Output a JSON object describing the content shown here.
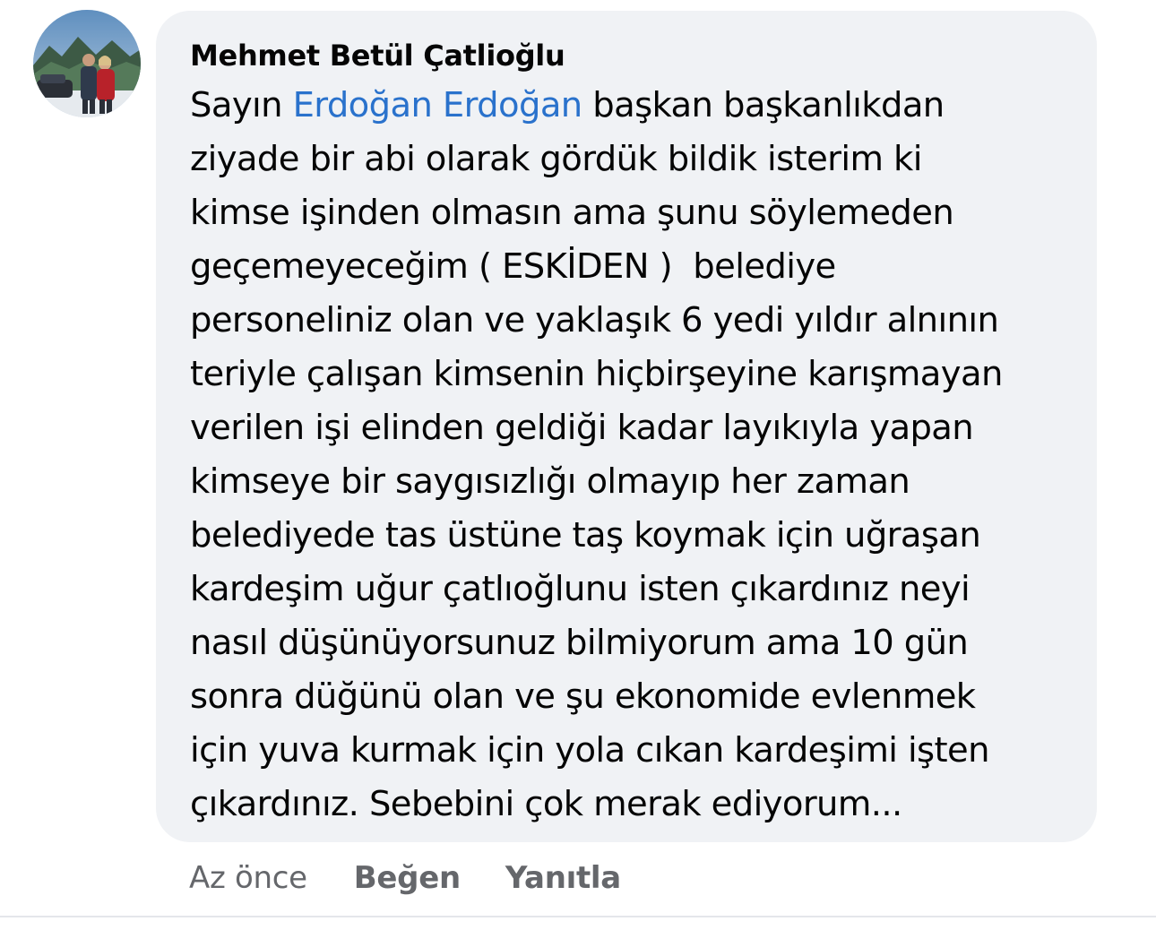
{
  "comment": {
    "author": "Mehmet Betül Çatlioğlu",
    "avatar_alt": "profile-photo",
    "body": {
      "line1_prefix": "Sayın ",
      "mention": "Erdoğan Erdoğan",
      "line1_suffix": " başkan başkanlıkdan",
      "lines": [
        "ziyade bir abi olarak gördük bildik isterim ki",
        "kimse işinden olmasın ama şunu söylemeden",
        "geçemeyeceğim ( ESKİDEN )  belediye",
        "personeliniz olan ve yaklaşık 6 yedi yıldır alnının",
        "teriyle çalışan kimsenin hiçbirşeyine karışmayan",
        "verilen işi elinden geldiği kadar layıkıyla yapan",
        "kimseye bir saygısızlığı olmayıp her zaman",
        "belediyede tas üstüne taş koymak için uğraşan",
        "kardeşim uğur çatlıoğlunu isten çıkardınız neyi",
        "nasıl düşünüyorsunuz bilmiyorum ama 10 gün",
        "sonra düğünü olan ve şu ekonomide evlenmek",
        "için yuva kurmak için yola cıkan kardeşimi işten",
        "çıkardınız. Sebebini çok merak ediyorum..."
      ]
    },
    "actions": {
      "time": "Az önce",
      "like": "Beğen",
      "reply": "Yanıtla"
    }
  },
  "colors": {
    "bubble_bg": "#f0f2f5",
    "mention": "#2a72cc",
    "text": "#050505",
    "muted": "#65676b"
  }
}
